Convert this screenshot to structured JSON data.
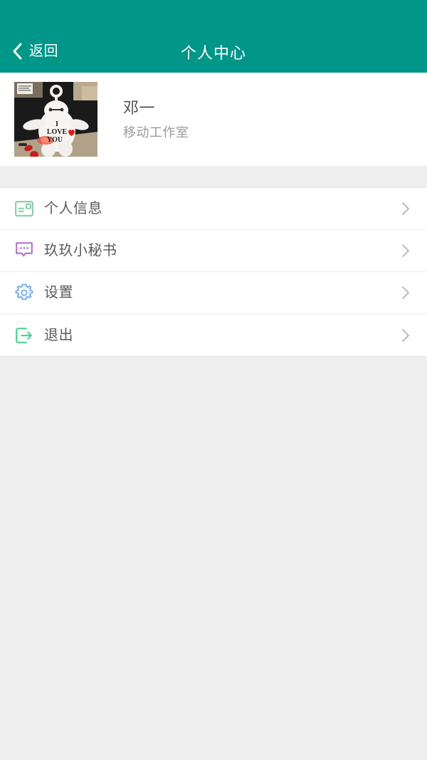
{
  "theme": {
    "header_bg": "#009688",
    "header_text": "#ffffff",
    "page_bg": "#efefef",
    "card_bg": "#ffffff",
    "divider": "#ededed",
    "primary_text": "#5a5a5a",
    "secondary_text": "#9b9b9b",
    "chevron": "#b4b4b4"
  },
  "header": {
    "back_label": "返回",
    "back_icon": "chevron-left-icon",
    "title": "个人中心"
  },
  "profile": {
    "avatar_icon": "avatar-photo",
    "avatar_description": "white plush keychain toy with I LOVE YOU text and red heart on a desk",
    "avatar_text_line1": "I",
    "avatar_text_line2": "LOVE",
    "avatar_text_line3": "YOU",
    "name": "邓一",
    "subtitle": "移动工作室"
  },
  "menu": {
    "items": [
      {
        "label": "个人信息",
        "icon": "id-card-icon",
        "icon_color": "#8dcdac",
        "arrow_icon": "chevron-right-icon"
      },
      {
        "label": "玖玖小秘书",
        "icon": "chat-bubble-icon",
        "icon_color": "#b277cd",
        "arrow_icon": "chevron-right-icon"
      },
      {
        "label": "设置",
        "icon": "gear-icon",
        "icon_color": "#74aee8",
        "arrow_icon": "chevron-right-icon"
      },
      {
        "label": "退出",
        "icon": "logout-icon",
        "icon_color": "#4cd292",
        "arrow_icon": "chevron-right-icon"
      }
    ]
  }
}
